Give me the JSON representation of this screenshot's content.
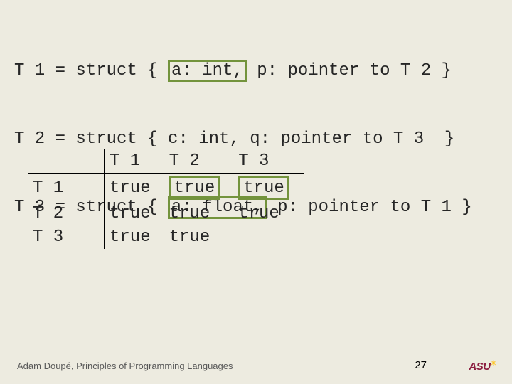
{
  "defs": {
    "r1": {
      "lhs": "T 1 = struct { ",
      "hl": "a: int,",
      "rest": " p: pointer to T 2 }"
    },
    "r2": {
      "lhs": "T 2 = struct { ",
      "mid": "c: int, q: pointer to T 3  }"
    },
    "r3": {
      "lhs": "T 3 = struct { ",
      "hl": "a: float,",
      "rest": " p: pointer to T 1 }"
    }
  },
  "table": {
    "cols": [
      "T 1",
      "T 2",
      "T 3"
    ],
    "rows": [
      {
        "label": "T 1",
        "cells": [
          "true",
          "true",
          "true"
        ],
        "box": [
          1,
          2
        ]
      },
      {
        "label": "T 2",
        "cells": [
          "true",
          "true",
          "true"
        ],
        "box": []
      },
      {
        "label": "T 3",
        "cells": [
          "true",
          "true",
          ""
        ],
        "box": []
      }
    ],
    "corner": ""
  },
  "footer": {
    "attribution": "Adam Doupé, Principles of Programming Languages",
    "page": "27",
    "logo": "ASU"
  }
}
